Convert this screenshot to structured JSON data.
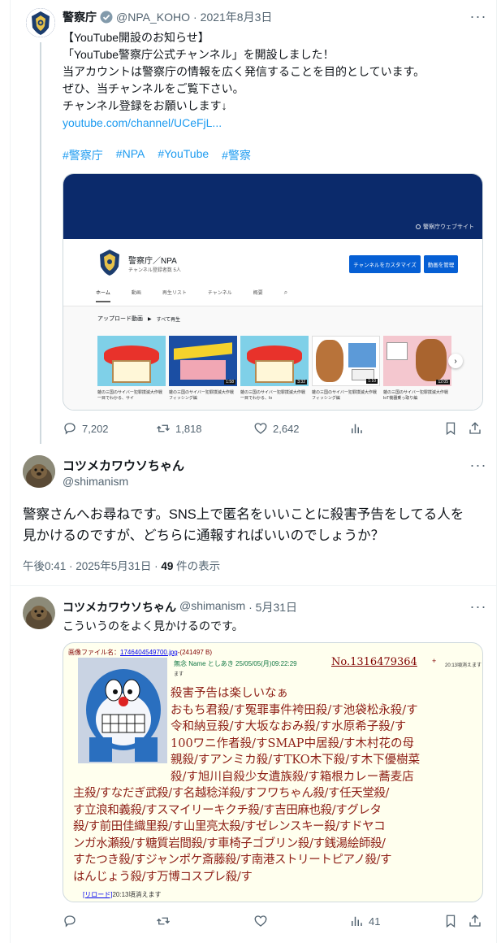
{
  "quoted": {
    "name": "警察庁",
    "handle": "@NPA_KOHO",
    "date": "2021年8月3日",
    "lines": [
      "【YouTube開設のお知らせ】",
      "「YouTube警察庁公式チャンネル」を開設しました！",
      "当アカウントは警察庁の情報を広く発信することを目的としています。",
      "ぜひ、当チャンネルをご覧下さい。",
      "チャンネル登録をお願いします↓"
    ],
    "link": "youtube.com/channel/UCeFjL...",
    "hashtags": [
      "#警察庁",
      "#NPA",
      "#YouTube",
      "#警察"
    ],
    "stats": {
      "replies": "7,202",
      "retweets": "1,818",
      "likes": "2,642"
    },
    "card": {
      "banner_link": "警察庁ウェブサイト",
      "channel_name": "警察庁／NPA",
      "subscribers": "チャンネル登録者数 5人",
      "customize_btn": "チャンネルをカスタマイズ",
      "manage_btn": "動画を管理",
      "tabs": [
        "ホーム",
        "動画",
        "再生リスト",
        "チャンネル",
        "概要"
      ],
      "section_title": "アップロード動画",
      "play_all": "すべて再生",
      "videos": [
        {
          "title": "雑の三国のサイバー犯罪撲滅大作戦　一目でわかる、サイ",
          "dur": ""
        },
        {
          "title": "雑の三国のサイバー犯罪撲滅大作戦　フィッシング編",
          "dur": "1:58"
        },
        {
          "title": "雑の三国のサイバー犯罪撲滅大作戦　一目でわかる、Io",
          "dur": "3:32"
        },
        {
          "title": "雑の三国のサイバー犯罪撲滅大作戦　フィッシング編",
          "dur": "1:10"
        },
        {
          "title": "雑の三国のサイバー犯罪撲滅大作戦　IoT機器乗っ取り編",
          "dur": "12:05"
        }
      ]
    }
  },
  "main": {
    "name": "コツメカワウソちゃん",
    "handle": "@shimanism",
    "text": [
      "警察さんへお尋ねです。SNS上で匿名をいいことに殺害予告をしてる人を",
      "見かけるのですが、どちらに通報すればいいのでしょうか？"
    ],
    "time": "午後0:41 · 2025年5月31日 · ",
    "views_count": "49",
    "views_label": " 件の表示"
  },
  "reply": {
    "name": "コツメカワウソちゃん",
    "handle": "@shimanism",
    "date": "· 5月31日",
    "text": "こういうのをよく見かけるのです。",
    "views": "41",
    "board": {
      "file_label": "画像ファイル名：",
      "file_name": "1746404549700.jpg",
      "file_size": "-(241497 B)",
      "post_head": "無念 Name としあき  25/05/05(月)09:22:29",
      "post_no": "No.1316479364",
      "plus": "+",
      "expire_small": "20:13頃消えます",
      "lines": [
        "殺害予告は楽しいなぁ",
        "おもち君殺/す冤罪事件袴田殺/す池袋松永殺/す",
        "令和納豆殺/す大坂なおみ殺/す水原希子殺/す",
        "100ワニ作者殺/すSMAP中居殺/す木村花の母",
        "親殺/すアンミカ殺/すTKO木下殺/す木下優樹菜",
        "殺/す旭川自殺少女遺族殺/す箱根カレー蕎麦店",
        "主殺/すなだぎ武殺/す名越稔洋殺/すフワちゃん殺/す任天堂殺/",
        "す立浪和義殺/すスマイリーキクチ殺/す吉田麻也殺/すグレタ",
        "殺/す前田佳織里殺/す山里亮太殺/すゼレンスキー殺/すドヤコ",
        "ンガ水瀬殺/す糖質岩間殺/す車椅子ゴブリン殺/す銭湯絵師殺/",
        "すたつき殺/すジャンポケ斎藤殺/す南港ストリートピアノ殺/す",
        "はんじょう殺/す万博コスプレ殺/す"
      ],
      "reload": "[リロード]",
      "footer": "20:13頃消えます"
    }
  },
  "colors": {
    "accent": "#1d9bf0",
    "text": "#0f1419",
    "muted": "#536471",
    "board_bg": "#ffffee",
    "board_red": "#8e1f16",
    "badge_blue": "#1d9bf0",
    "yt_button": "#065fd4",
    "banner": "#0b2a6b"
  },
  "icons": [
    "more-icon",
    "verified-badge-icon",
    "reply-icon",
    "retweet-icon",
    "like-icon",
    "views-icon",
    "bookmark-icon",
    "share-icon"
  ]
}
